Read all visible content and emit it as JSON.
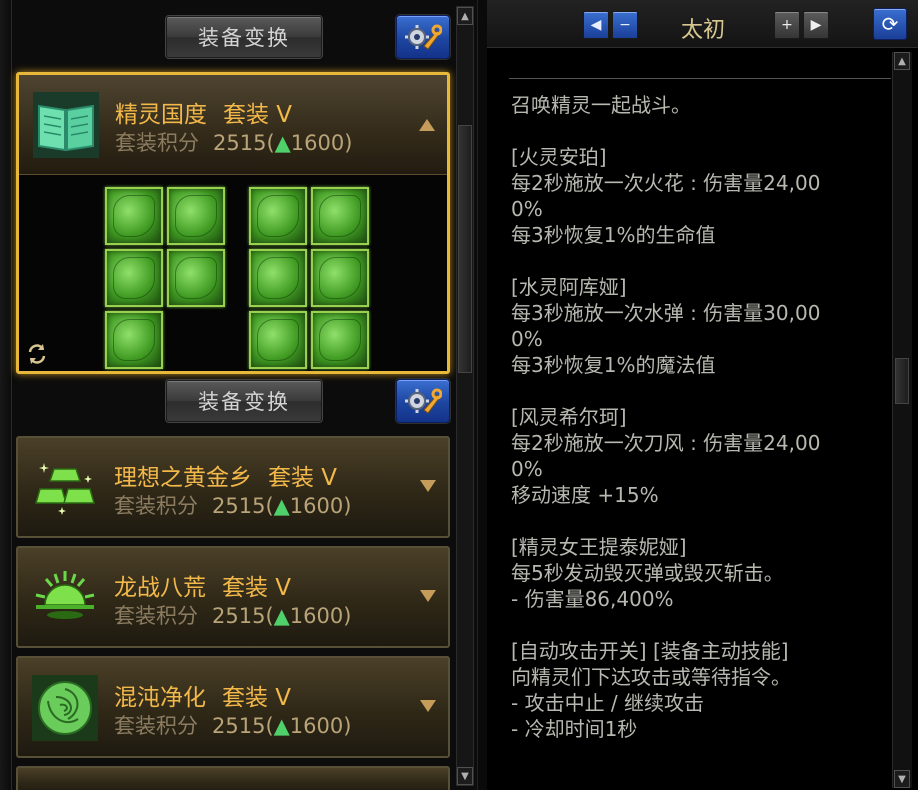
{
  "left": {
    "switch_label": "装备变换",
    "sets": [
      {
        "title": "精灵国度",
        "grade": "套装 V",
        "score_label": "套装积分",
        "score": "2515(",
        "up_glyph": "▲",
        "up_value": "1600",
        "close": ")",
        "icon": "book-icon",
        "expanded": true
      },
      {
        "title": "理想之黄金乡",
        "grade": "套装 V",
        "score_label": "套装积分",
        "score": "2515(",
        "up_glyph": "▲",
        "up_value": "1600",
        "close": ")",
        "icon": "gold-bars-icon",
        "expanded": false
      },
      {
        "title": "龙战八荒",
        "grade": "套装 V",
        "score_label": "套装积分",
        "score": "2515(",
        "up_glyph": "▲",
        "up_value": "1600",
        "close": ")",
        "icon": "sunrise-icon",
        "expanded": false
      },
      {
        "title": "混沌净化",
        "grade": "套装 V",
        "score_label": "套装积分",
        "score": "2515(",
        "up_glyph": "▲",
        "up_value": "1600",
        "close": ")",
        "icon": "rose-icon",
        "expanded": false
      }
    ],
    "slot_count": 10
  },
  "right": {
    "title": "太初",
    "nav": {
      "prev": "◀",
      "minus": "−",
      "plus": "+",
      "next": "▶"
    },
    "refresh": "⟳",
    "description": [
      "召唤精灵一起战斗。",
      "",
      "[火灵安珀]",
      "每2秒施放一次火花 : 伤害量24,00",
      "0%",
      "每3秒恢复1%的生命值",
      "",
      "[水灵阿库娅]",
      "每3秒施放一次水弹 : 伤害量30,00",
      "0%",
      "每3秒恢复1%的魔法值",
      "",
      "[风灵希尔珂]",
      "每2秒施放一次刀风 : 伤害量24,00",
      "0%",
      "移动速度 +15%",
      "",
      "[精灵女王提泰妮娅]",
      "每5秒发动毁灭弹或毁灭斩击。",
      "- 伤害量86,400%",
      "",
      "[自动攻击开关] [装备主动技能]",
      "向精灵们下达攻击或等待指令。",
      "- 攻击中止 / 继续攻击",
      "- 冷却时间1秒"
    ]
  },
  "colors": {
    "gold": "#f2b84a",
    "active_border": "#e8b83a",
    "slot_green": "#6ac83a",
    "up_green": "#4fd06a"
  }
}
